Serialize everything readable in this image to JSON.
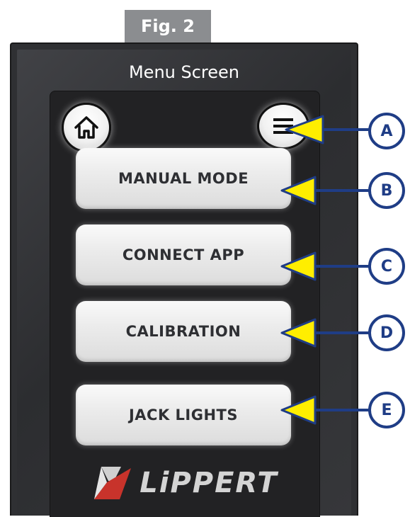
{
  "figure_label": "Fig. 2",
  "screen_title": "Menu Screen",
  "icons": {
    "home": "home-icon",
    "menu": "hamburger-menu-icon"
  },
  "menu_items": [
    {
      "label": "MANUAL MODE"
    },
    {
      "label": "CONNECT APP"
    },
    {
      "label": "CALIBRATION"
    },
    {
      "label": "JACK LIGHTS"
    }
  ],
  "brand": "LiPPERT",
  "callouts": [
    "A",
    "B",
    "C",
    "D",
    "E"
  ],
  "colors": {
    "callout_blue": "#1f3d86",
    "arrow_yellow": "#ffee00",
    "logo_red": "#c8332b",
    "device_dark": "#2f3033"
  }
}
